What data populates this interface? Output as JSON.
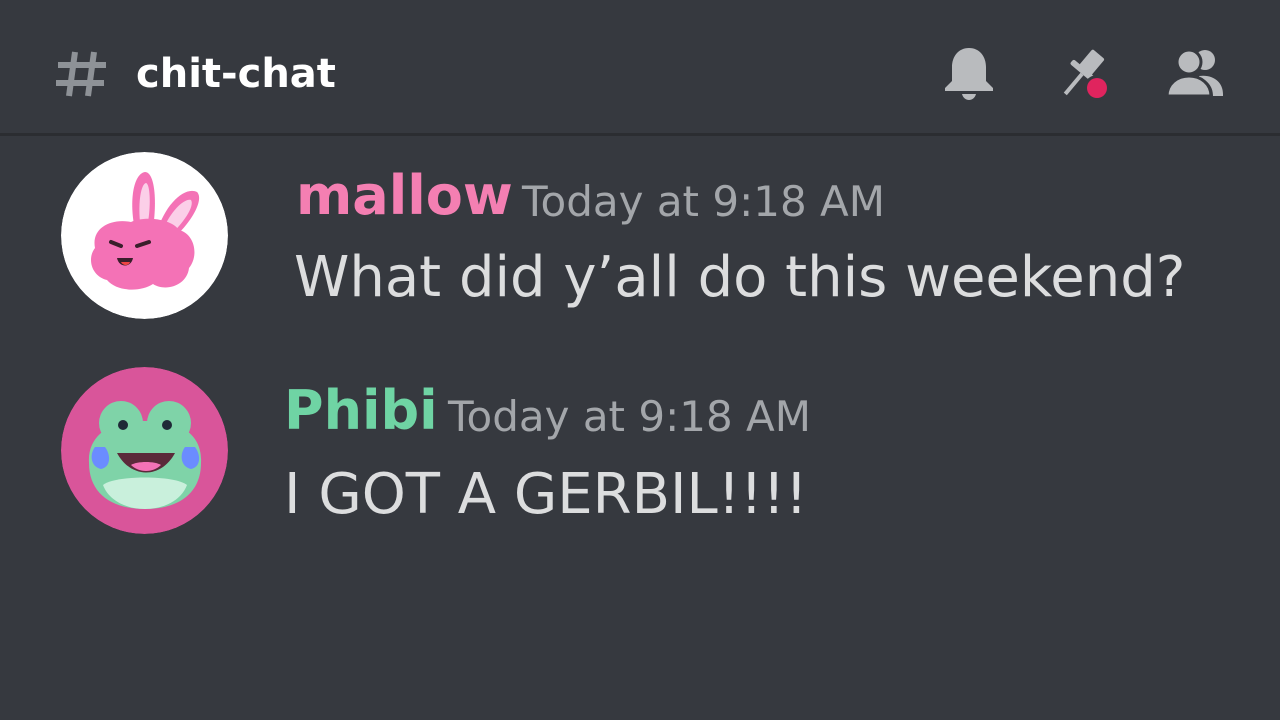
{
  "channel": {
    "name": "chit-chat",
    "icon": "hash-icon"
  },
  "header_actions": [
    {
      "icon": "bell-icon",
      "label": "Notification Settings"
    },
    {
      "icon": "pin-icon",
      "label": "Pinned Messages",
      "badge_color": "#e0245e"
    },
    {
      "icon": "members-icon",
      "label": "Member List"
    }
  ],
  "messages": [
    {
      "username": "mallow",
      "username_color": "#f47fb2",
      "timestamp": "Today at 9:18 AM",
      "content": "What did y’all do this weekend?",
      "avatar": "pink-bunny-avatar"
    },
    {
      "username": "Phibi",
      "username_color": "#6fd4a4",
      "timestamp": "Today at 9:18 AM",
      "content": "I GOT A GERBIL!!!!",
      "avatar": "green-frog-avatar"
    }
  ],
  "colors": {
    "background": "#36393f",
    "header_divider": "#2b2d31",
    "text": "#dcddde",
    "muted": "#a3a6aa",
    "icon": "#b9bbbe"
  }
}
